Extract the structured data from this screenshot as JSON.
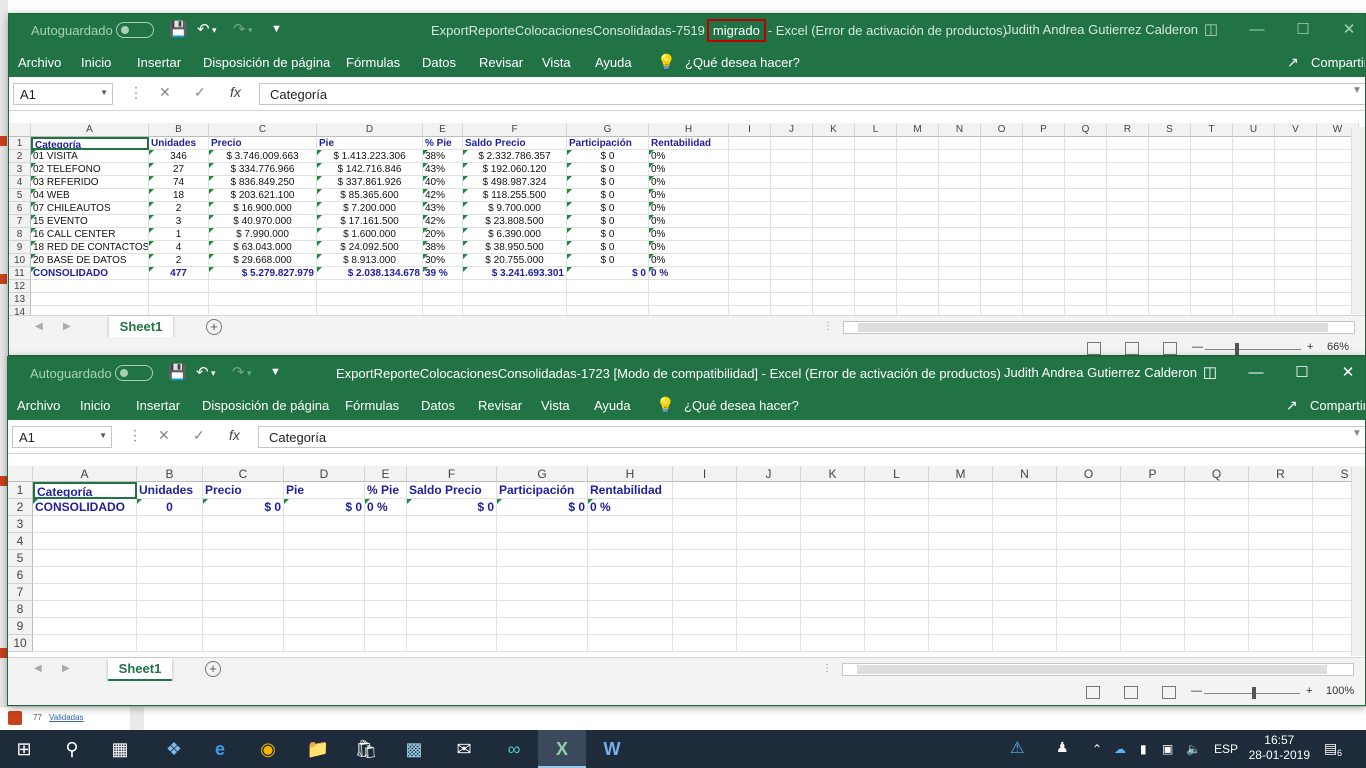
{
  "app": {
    "autosave_label": "Autoguardado",
    "user": "Judith Andrea Gutierrez Calderon",
    "colors": {
      "excel_green": "#217346",
      "highlight": "#c00000"
    },
    "menu": [
      "Archivo",
      "Inicio",
      "Insertar",
      "Disposición de página",
      "Fórmulas",
      "Datos",
      "Revisar",
      "Vista",
      "Ayuda"
    ],
    "tell_me": "¿Qué desea hacer?",
    "share": "Compartir"
  },
  "window1": {
    "title_pre": "ExportReporteColocacionesConsolidadas-7519",
    "title_hl": "migrado",
    "title_post": "-  Excel (Error de activación de productos)",
    "namebox": "A1",
    "formula": "Categoría",
    "columns": [
      "A",
      "B",
      "C",
      "D",
      "E",
      "F",
      "G",
      "H",
      "I",
      "J",
      "K",
      "L",
      "M",
      "N",
      "O",
      "P",
      "Q",
      "R",
      "S",
      "T",
      "U",
      "V",
      "W"
    ],
    "rows": [
      [
        "Categoría",
        "Unidades",
        "Precio",
        "Pie",
        "% Pie",
        "Saldo Precio",
        "Participación",
        "Rentabilidad"
      ],
      [
        "01 VISITA",
        "346",
        "$ 3.746.009.663",
        "$ 1.413.223.306",
        "38%",
        "$ 2.332.786.357",
        "$ 0",
        "0%"
      ],
      [
        "02 TELEFONO",
        "27",
        "$ 334.776.966",
        "$ 142.716.846",
        "43%",
        "$ 192.060.120",
        "$ 0",
        "0%"
      ],
      [
        "03 REFERIDO",
        "74",
        "$ 836.849.250",
        "$ 337.861.926",
        "40%",
        "$ 498.987.324",
        "$ 0",
        "0%"
      ],
      [
        "04 WEB",
        "18",
        "$ 203.621.100",
        "$ 85.365.600",
        "42%",
        "$ 118.255.500",
        "$ 0",
        "0%"
      ],
      [
        "07 CHILEAUTOS",
        "2",
        "$ 16.900.000",
        "$ 7.200.000",
        "43%",
        "$ 9.700.000",
        "$ 0",
        "0%"
      ],
      [
        "15 EVENTO",
        "3",
        "$ 40.970.000",
        "$ 17.161.500",
        "42%",
        "$ 23.808.500",
        "$ 0",
        "0%"
      ],
      [
        "16 CALL CENTER",
        "1",
        "$ 7.990.000",
        "$ 1.600.000",
        "20%",
        "$ 6.390.000",
        "$ 0",
        "0%"
      ],
      [
        "18 RED DE CONTACTOS",
        "4",
        "$ 63.043.000",
        "$ 24.092.500",
        "38%",
        "$ 38.950.500",
        "$ 0",
        "0%"
      ],
      [
        "20 BASE DE DATOS",
        "2",
        "$ 29.668.000",
        "$ 8.913.000",
        "30%",
        "$ 20.755.000",
        "$ 0",
        "0%"
      ],
      [
        "CONSOLIDADO",
        "477",
        "$ 5.279.827.979",
        "$ 2.038.134.678",
        "39 %",
        "$ 3.241.693.301",
        "$ 0",
        "0 %"
      ]
    ],
    "row_numbers": [
      "1",
      "2",
      "3",
      "4",
      "5",
      "6",
      "7",
      "8",
      "9",
      "10",
      "11",
      "12",
      "13",
      "14"
    ],
    "sheet_tab": "Sheet1",
    "zoom": "66%"
  },
  "window2": {
    "title": "ExportReporteColocacionesConsolidadas-1723  [Modo de compatibilidad]  -  Excel (Error de activación de productos)",
    "namebox": "A1",
    "formula": "Categoría",
    "columns": [
      "A",
      "B",
      "C",
      "D",
      "E",
      "F",
      "G",
      "H",
      "I",
      "J",
      "K",
      "L",
      "M",
      "N",
      "O",
      "P",
      "Q",
      "R",
      "S"
    ],
    "rows": [
      [
        "Categoría",
        "Unidades",
        "Precio",
        "Pie",
        "% Pie",
        "Saldo Precio",
        "Participación",
        "Rentabilidad"
      ],
      [
        "CONSOLIDADO",
        "0",
        "$ 0",
        "$ 0",
        "0 %",
        "$ 0",
        "$ 0",
        "0 %"
      ]
    ],
    "row_numbers": [
      "1",
      "2",
      "3",
      "4",
      "5",
      "6",
      "7",
      "8",
      "9",
      "10"
    ],
    "sheet_tab": "Sheet1",
    "zoom": "100%"
  },
  "background": {
    "snippet_num": "77",
    "snippet_link": "Validadas"
  },
  "taskbar": {
    "language": "ESP",
    "time": "16:57",
    "date": "28-01-2019",
    "notifications": "6"
  }
}
